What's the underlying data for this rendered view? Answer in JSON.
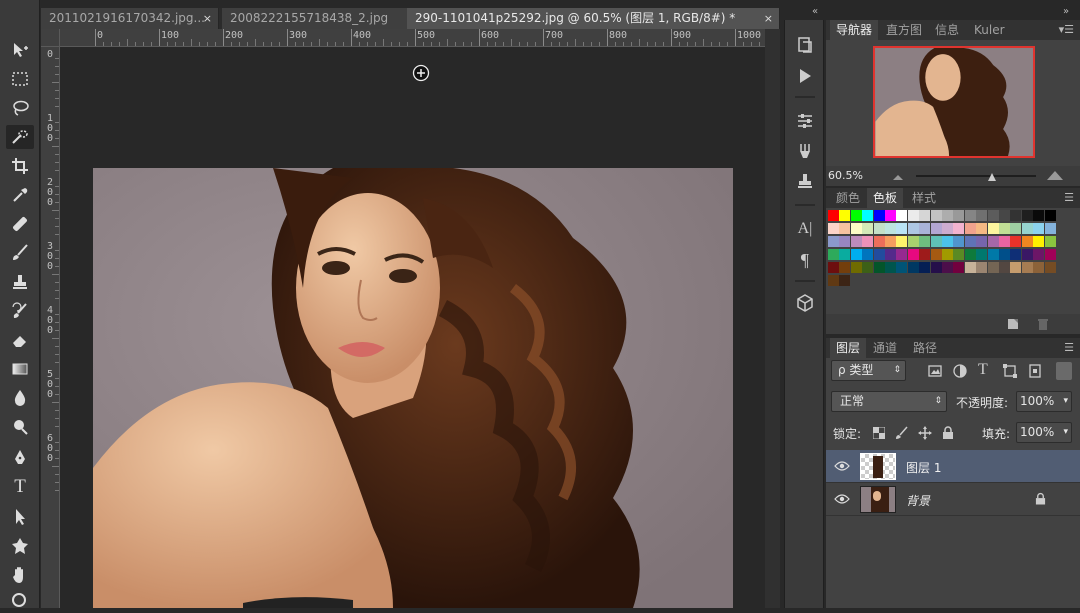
{
  "tabs": [
    {
      "label": "2011021916170342.jpg...",
      "close": "×"
    },
    {
      "label": "2008222155718438_2.jpg",
      "close": "×"
    },
    {
      "label": "290-1101041p25292.jpg @ 60.5% (图层 1, RGB/8#) *",
      "close": "×"
    }
  ],
  "ruler": {
    "h_labels": [
      "0",
      "100",
      "200",
      "300",
      "400",
      "500",
      "600",
      "700",
      "800",
      "900",
      "1000"
    ],
    "v_labels": [
      "0",
      "1 0 0",
      "2 0 0",
      "3 0 0",
      "4 0 0",
      "5 0 0",
      "6 0 0"
    ]
  },
  "toolbar": {
    "tools": [
      "move-icon",
      "marquee-icon",
      "lasso-icon",
      "quick-select-icon",
      "crop-icon",
      "eyedropper-icon",
      "healing-icon",
      "brush-icon",
      "stamp-icon",
      "history-brush-icon",
      "eraser-icon",
      "gradient-icon",
      "blur-icon",
      "dodge-icon",
      "pen-icon",
      "type-icon",
      "path-select-icon",
      "shape-icon",
      "hand-icon",
      "zoom-icon"
    ],
    "type_glyph": "T"
  },
  "strip": {
    "char_glyph": "A|",
    "para_glyph": "¶"
  },
  "navigator": {
    "tabs": [
      "导航器",
      "直方图",
      "信息",
      "Kuler"
    ],
    "zoom": "60.5%",
    "zoom_level": 0.63
  },
  "swatches": {
    "tabs": [
      "颜色",
      "色板",
      "样式"
    ],
    "colors": [
      "#ff0000",
      "#ffff00",
      "#00ff00",
      "#00ffff",
      "#0000ff",
      "#ff00ff",
      "#ffffff",
      "#ebebeb",
      "#d6d6d6",
      "#c2c2c2",
      "#adadad",
      "#999999",
      "#858585",
      "#707070",
      "#5c5c5c",
      "#474747",
      "#333333",
      "#1f1f1f",
      "#0a0a0a",
      "#000000",
      "#fbd3c8",
      "#f7c2a0",
      "#fcfcc5",
      "#d3e9b7",
      "#c3e0c7",
      "#bde5df",
      "#bae4f5",
      "#aec7e4",
      "#a9b3d8",
      "#b3a6d2",
      "#cdaccf",
      "#f2b3cf",
      "#f0a28d",
      "#f5b983",
      "#fdf59e",
      "#c1de95",
      "#9fcfa2",
      "#96d4cf",
      "#8cd3ee",
      "#84b3dc",
      "#8b99cb",
      "#9886c1",
      "#bd8bbc",
      "#ed91b9",
      "#ec6e5a",
      "#f59e5f",
      "#fff36b",
      "#a8d16e",
      "#6ebd7f",
      "#5fc1b6",
      "#4cc3e8",
      "#5095cd",
      "#5f73b7",
      "#7665ad",
      "#a767a8",
      "#ea64a1",
      "#e8322a",
      "#f08621",
      "#fff100",
      "#8bc43f",
      "#2eaa5b",
      "#0aac9f",
      "#00aeef",
      "#0075be",
      "#224c9e",
      "#542a8b",
      "#952990",
      "#e7097f",
      "#9e1b1b",
      "#a65a12",
      "#a19b00",
      "#5a8a24",
      "#0e7a3b",
      "#00786e",
      "#0079a8",
      "#004f8a",
      "#0f2f76",
      "#3a1865",
      "#6c1667",
      "#a00058",
      "#6d0e0e",
      "#733e0c",
      "#6f6b00",
      "#3d6017",
      "#03552a",
      "#00554d",
      "#005476",
      "#003862",
      "#051f54",
      "#250f4a",
      "#4c0f4a",
      "#72003e",
      "#c7b299",
      "#9b8571",
      "#746554",
      "#534741",
      "#c69c6d",
      "#a67c52",
      "#8c6239",
      "#754c24",
      "#603913",
      "#3c2415"
    ]
  },
  "layers": {
    "tabs": [
      "图层",
      "通道",
      "路径"
    ],
    "filter_label": "ρ 类型",
    "blend_mode": "正常",
    "opacity_label": "不透明度:",
    "opacity_value": "100%",
    "lock_label": "锁定:",
    "fill_label": "填充:",
    "fill_value": "100%",
    "items": [
      {
        "name": "图层 1",
        "selected": true
      },
      {
        "name": "背景",
        "selected": false,
        "locked": true
      }
    ]
  }
}
